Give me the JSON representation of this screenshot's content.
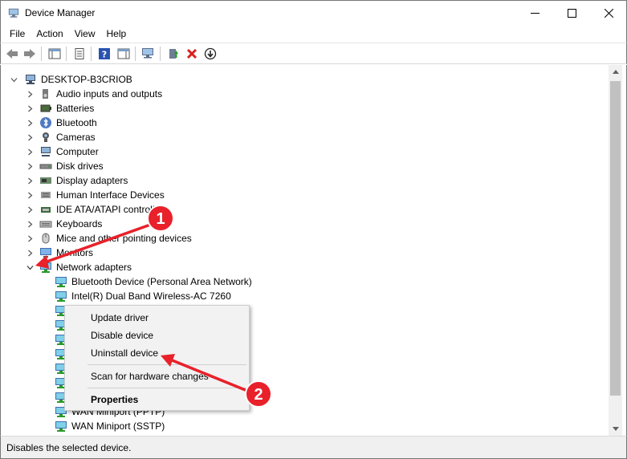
{
  "window": {
    "title": "Device Manager",
    "minimize": "minimize",
    "maximize": "maximize",
    "close": "close"
  },
  "menu": [
    "File",
    "Action",
    "View",
    "Help"
  ],
  "toolbar_icons": [
    "back-arrow-icon",
    "forward-arrow-icon",
    "show-hide-console-tree-icon",
    "properties-icon",
    "help-icon",
    "action-pane-icon",
    "scan-hardware-icon",
    "enable-device-icon",
    "uninstall-device-icon",
    "update-driver-icon"
  ],
  "tree": {
    "root": "DESKTOP-B3CRIOB",
    "categories": [
      "Audio inputs and outputs",
      "Batteries",
      "Bluetooth",
      "Cameras",
      "Computer",
      "Disk drives",
      "Display adapters",
      "Human Interface Devices",
      "IDE ATA/ATAPI controll",
      "Keyboards",
      "Mice and other pointing devices",
      "Monitors",
      "Network adapters"
    ],
    "network_children": [
      "Bluetooth Device (Personal Area Network)",
      "Intel(R) Dual Band Wireless-AC 7260",
      "",
      "",
      "",
      "",
      "",
      "",
      "",
      "WAN Miniport (PPTP)",
      "WAN Miniport (SSTP)"
    ]
  },
  "context_menu": {
    "update_driver": "Update driver",
    "disable_device": "Disable device",
    "uninstall_device": "Uninstall device",
    "scan_hardware": "Scan for hardware changes",
    "properties": "Properties"
  },
  "annotations": {
    "marker_1": "1",
    "marker_2": "2",
    "color": "#e8212a"
  },
  "status": "Disables the selected device."
}
